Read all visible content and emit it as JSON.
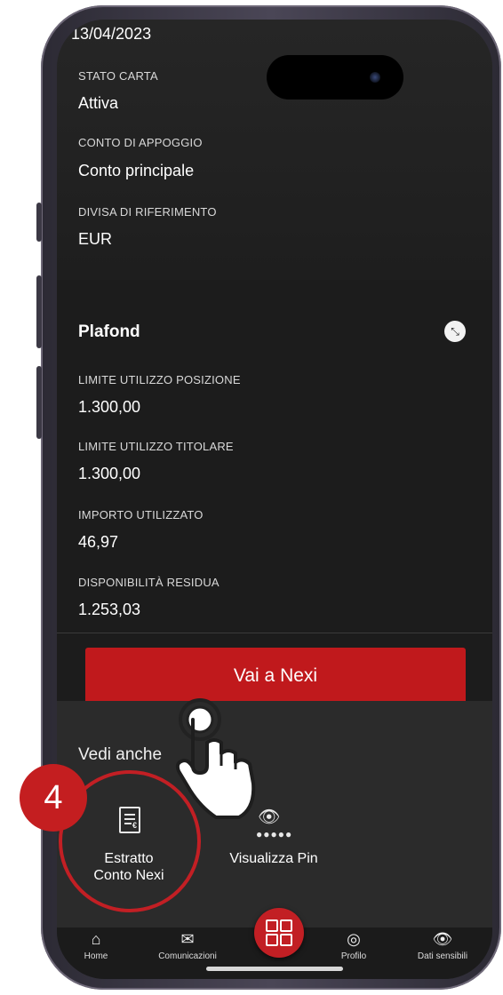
{
  "top": {
    "date_partial": "13/04/2023",
    "fields": [
      {
        "label": "STATO CARTA",
        "value": "Attiva"
      },
      {
        "label": "CONTO DI APPOGGIO",
        "value": "Conto principale"
      },
      {
        "label": "DIVISA DI RIFERIMENTO",
        "value": "EUR"
      }
    ]
  },
  "plafond": {
    "title": "Plafond",
    "fields": [
      {
        "label": "LIMITE UTILIZZO POSIZIONE",
        "value": "1.300,00"
      },
      {
        "label": "LIMITE UTILIZZO TITOLARE",
        "value": "1.300,00"
      },
      {
        "label": "IMPORTO UTILIZZATO",
        "value": "46,97"
      },
      {
        "label": "DISPONIBILITÀ RESIDUA",
        "value": "1.253,03"
      }
    ],
    "cta_label": "Vai a Nexi"
  },
  "vedi_anche": {
    "title": "Vedi anche",
    "items": [
      {
        "line1": "Estratto",
        "line2": "Conto Nexi",
        "icon": "document-euro-icon"
      },
      {
        "line1": "Visualizza Pin",
        "icon": "eye-pin-icon"
      }
    ]
  },
  "bottom_nav": {
    "items": [
      {
        "label": "Home",
        "icon": "home-icon"
      },
      {
        "label": "Comunicazioni",
        "icon": "mail-icon"
      },
      {
        "label": "",
        "icon": "grid-icon"
      },
      {
        "label": "Profilo",
        "icon": "profile-icon"
      },
      {
        "label": "Dati sensibili",
        "icon": "eye-icon"
      }
    ]
  },
  "annotation": {
    "step_number": "4",
    "accent_color": "#c41e20"
  }
}
